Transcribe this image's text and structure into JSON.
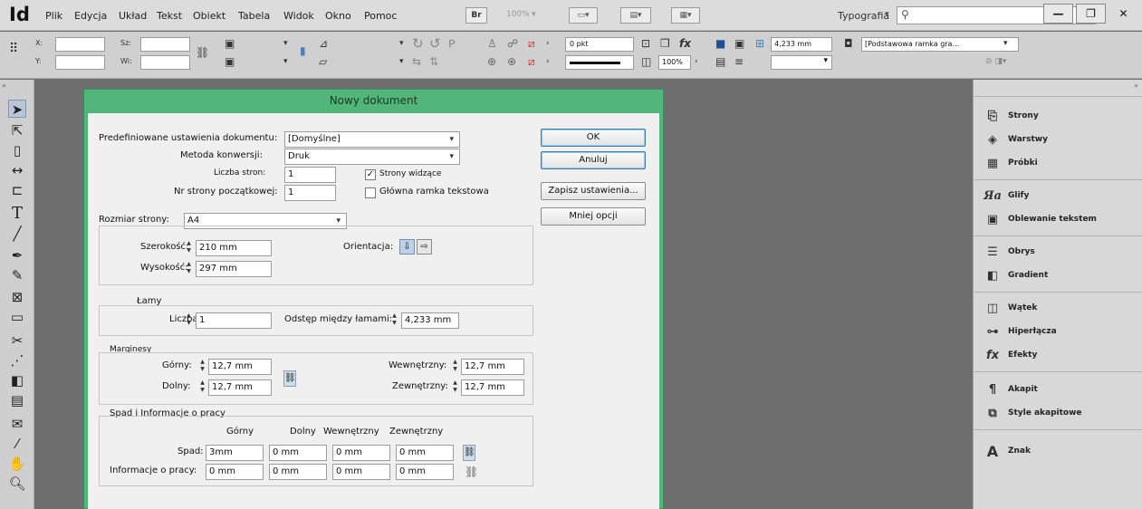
{
  "app": {
    "logo": "Id",
    "zoom": "100%",
    "workspace": "Typografia"
  },
  "menu": [
    "Plik",
    "Edycja",
    "Układ",
    "Tekst",
    "Obiekt",
    "Tabela",
    "Widok",
    "Okno",
    "Pomoc"
  ],
  "menu_buttons": {
    "bridge": "Br"
  },
  "controlbar": {
    "x_label": "X:",
    "y_label": "Y:",
    "w_label": "Sz:",
    "h_label": "Wi:",
    "stroke_weight": "0 pkt",
    "scale_percent": "100%",
    "gutter": "4,233 mm",
    "frame_style": "[Podstawowa ramka gra..."
  },
  "dialog": {
    "title": "Nowy dokument",
    "preset_label": "Predefiniowane ustawienia dokumentu:",
    "preset_value": "[Domyślne]",
    "intent_label": "Metoda konwersji:",
    "intent_value": "Druk",
    "pages_label": "Liczba stron:",
    "pages_value": "1",
    "facing_label": "Strony widzące",
    "facing_checked": true,
    "start_label": "Nr strony początkowej:",
    "start_value": "1",
    "master_label": "Główna ramka tekstowa",
    "master_checked": false,
    "size_label": "Rozmiar strony:",
    "size_value": "A4",
    "width_label": "Szerokość:",
    "width_value": "210 mm",
    "height_label": "Wysokość:",
    "height_value": "297 mm",
    "orientation_label": "Orientacja:",
    "columns_title": "Łamy",
    "columns_count_label": "Liczba:",
    "columns_count_value": "1",
    "gutter_label": "Odstęp między łamami:",
    "gutter_value": "4,233 mm",
    "margins_title": "Marginesy",
    "top_label": "Górny:",
    "top_value": "12,7 mm",
    "bottom_label": "Dolny:",
    "bottom_value": "12,7 mm",
    "inside_label": "Wewnętrzny:",
    "inside_value": "12,7 mm",
    "outside_label": "Zewnętrzny:",
    "outside_value": "12,7 mm",
    "bleed_title": "Spad i Informacje o pracy",
    "bleed_headers": [
      "Górny",
      "Dolny",
      "Wewnętrzny",
      "Zewnętrzny"
    ],
    "bleed_label": "Spad:",
    "bleed_values": [
      "3mm",
      "0 mm",
      "0 mm",
      "0 mm"
    ],
    "slug_label": "Informacje o pracy:",
    "slug_values": [
      "0 mm",
      "0 mm",
      "0 mm",
      "0 mm"
    ],
    "buttons": {
      "ok": "OK",
      "cancel": "Anuluj",
      "save": "Zapisz ustawienia...",
      "fewer": "Mniej opcji"
    }
  },
  "panels": [
    {
      "label": "Strony",
      "icon": "pages-icon"
    },
    {
      "label": "Warstwy",
      "icon": "layers-icon"
    },
    {
      "label": "Próbki",
      "icon": "swatches-icon"
    },
    {
      "label": "Glify",
      "icon": "glyphs-icon"
    },
    {
      "label": "Oblewanie tekstem",
      "icon": "text-wrap-icon"
    },
    {
      "label": "Obrys",
      "icon": "stroke-icon"
    },
    {
      "label": "Gradient",
      "icon": "gradient-icon"
    },
    {
      "label": "Wątek",
      "icon": "thread-icon"
    },
    {
      "label": "Hiperłącza",
      "icon": "hyperlinks-icon"
    },
    {
      "label": "Efekty",
      "icon": "effects-icon"
    },
    {
      "label": "Akapit",
      "icon": "paragraph-icon"
    },
    {
      "label": "Style akapitowe",
      "icon": "paragraph-styles-icon"
    },
    {
      "label": "Znak",
      "icon": "character-icon"
    }
  ],
  "tools": [
    "selection-tool-icon",
    "direct-selection-tool-icon",
    "page-tool-icon",
    "gap-tool-icon",
    "content-collector-icon",
    "type-tool-icon",
    "line-tool-icon",
    "pen-tool-icon",
    "pencil-tool-icon",
    "rectangle-frame-tool-icon",
    "rectangle-tool-icon",
    "scissors-tool-icon",
    "free-transform-tool-icon",
    "gradient-swatch-tool-icon",
    "gradient-feather-tool-icon",
    "note-tool-icon",
    "eyedropper-tool-icon",
    "hand-tool-icon",
    "zoom-tool-icon"
  ]
}
